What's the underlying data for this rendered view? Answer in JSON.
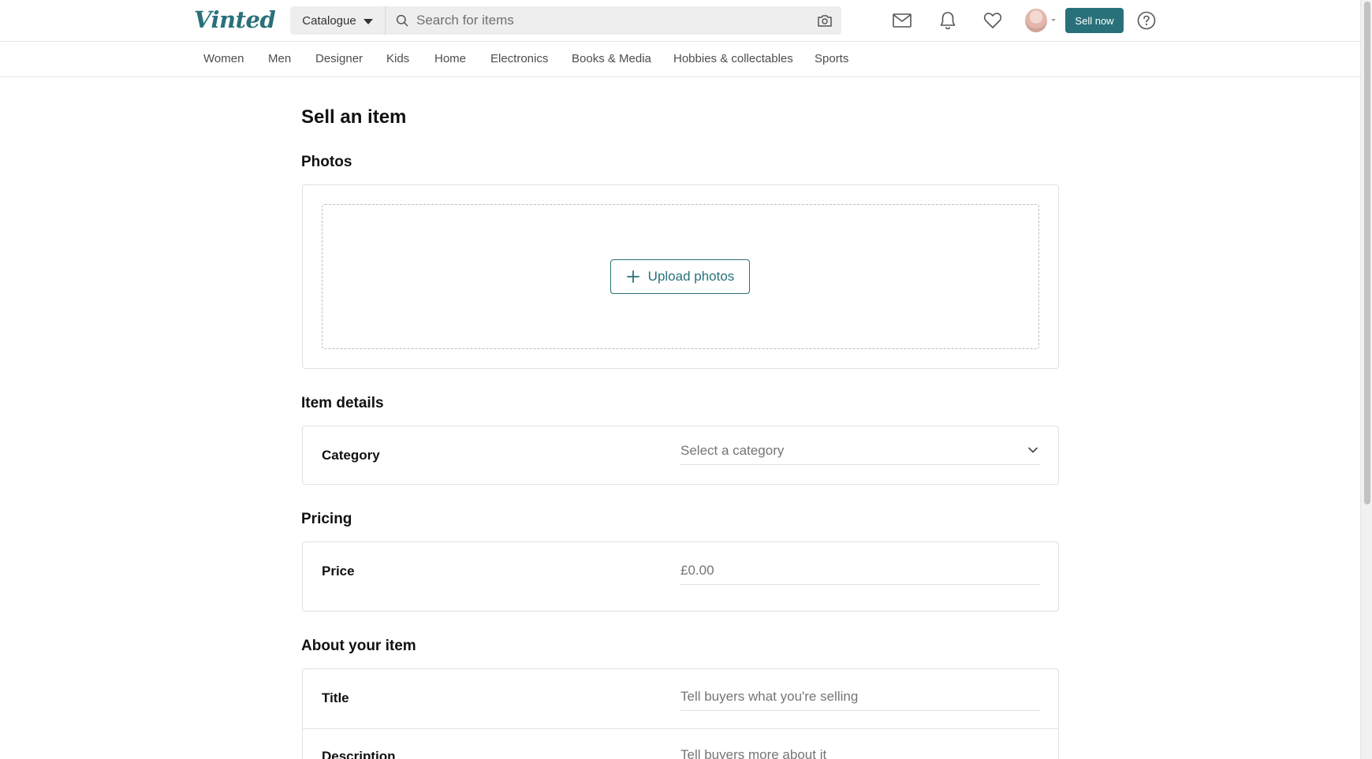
{
  "header": {
    "logo": "Vinted",
    "catalogue_label": "Catalogue",
    "search_placeholder": "Search for items",
    "sell_now_label": "Sell now",
    "icons": [
      "mail-icon",
      "bell-icon",
      "heart-icon",
      "help-icon"
    ]
  },
  "nav": {
    "items": [
      "Women",
      "Men",
      "Designer",
      "Kids",
      "Home",
      "Electronics",
      "Books & Media",
      "Hobbies & collectables",
      "Sports"
    ]
  },
  "page": {
    "title": "Sell an item",
    "photos": {
      "section_title": "Photos",
      "upload_label": "Upload photos"
    },
    "item_details": {
      "section_title": "Item details",
      "category_label": "Category",
      "category_placeholder": "Select a category"
    },
    "pricing": {
      "section_title": "Pricing",
      "price_label": "Price",
      "price_placeholder": "£0.00"
    },
    "about": {
      "section_title": "About your item",
      "title_label": "Title",
      "title_placeholder": "Tell buyers what you're selling",
      "description_label": "Description",
      "description_placeholder": "Tell buyers more about it"
    }
  },
  "colors": {
    "brand": "#29717a",
    "text": "#111111",
    "muted": "#757575",
    "border": "#e0e0e0"
  }
}
